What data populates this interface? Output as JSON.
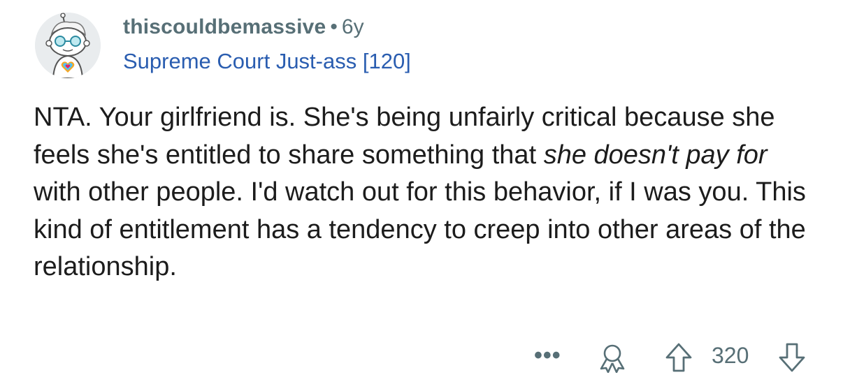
{
  "comment": {
    "username": "thiscouldbemassive",
    "separator": "•",
    "age": "6y",
    "flair": "Supreme Court Just-ass [120]",
    "body_prefix": "NTA.  Your girlfriend is.  She's being unfairly critical because she feels she's entitled to share something that ",
    "body_emphasis": "she doesn't pay for",
    "body_suffix": " with other people.  I'd watch out for this behavior, if I was you.  This kind of entitlement has a tendency to creep into other areas of the relationship.",
    "score": "320"
  },
  "icons": {
    "avatar": "snoo-avatar-icon",
    "more": "more-options-icon",
    "award": "award-icon",
    "upvote": "upvote-arrow-icon",
    "downvote": "downvote-arrow-icon"
  },
  "colors": {
    "meta": "#576f76",
    "flair": "#2a5db0",
    "text": "#1c1c1c",
    "background": "#ffffff"
  }
}
